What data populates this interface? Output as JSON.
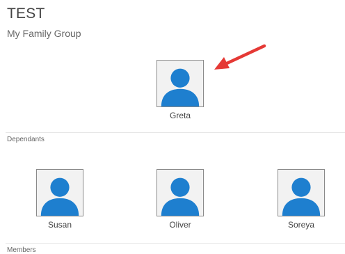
{
  "header": {
    "title": "TEST",
    "subtitle": "My Family Group"
  },
  "primary_member": {
    "name": "Greta",
    "icon": "person-avatar-icon"
  },
  "annotation": {
    "icon": "red-arrow-icon",
    "color": "#e53935"
  },
  "sections": {
    "dependants_label": "Dependants",
    "members_label": "Members"
  },
  "dependants": [
    {
      "name": "Susan",
      "icon": "person-avatar-icon"
    },
    {
      "name": "Oliver",
      "icon": "person-avatar-icon"
    },
    {
      "name": "Soreya",
      "icon": "person-avatar-icon"
    }
  ],
  "colors": {
    "avatar_fill": "#1e7fcf",
    "avatar_background": "#f2f2f2"
  }
}
